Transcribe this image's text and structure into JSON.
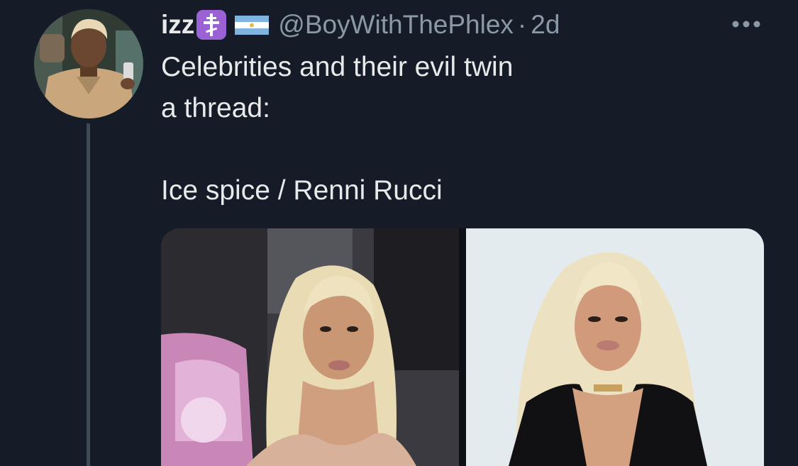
{
  "tweet": {
    "display_name": "izz",
    "emoji_1": "orthodox-cross-emoji",
    "emoji_2": "argentina-flag-emoji",
    "handle": "@BoyWithThePhlex",
    "separator": "·",
    "timestamp": "2d",
    "text_lines": [
      "Celebrities and their evil twin",
      "a thread:",
      "",
      "Ice spice / Renni Rucci"
    ],
    "more_icon": "more-options-icon",
    "media": [
      {
        "description_icon": "photo-left"
      },
      {
        "description_icon": "photo-right"
      }
    ]
  },
  "colors": {
    "background": "#151c27",
    "primary_text": "#e7e9ea",
    "secondary_text": "#8b98a5",
    "thread_line": "#3f4a56"
  }
}
